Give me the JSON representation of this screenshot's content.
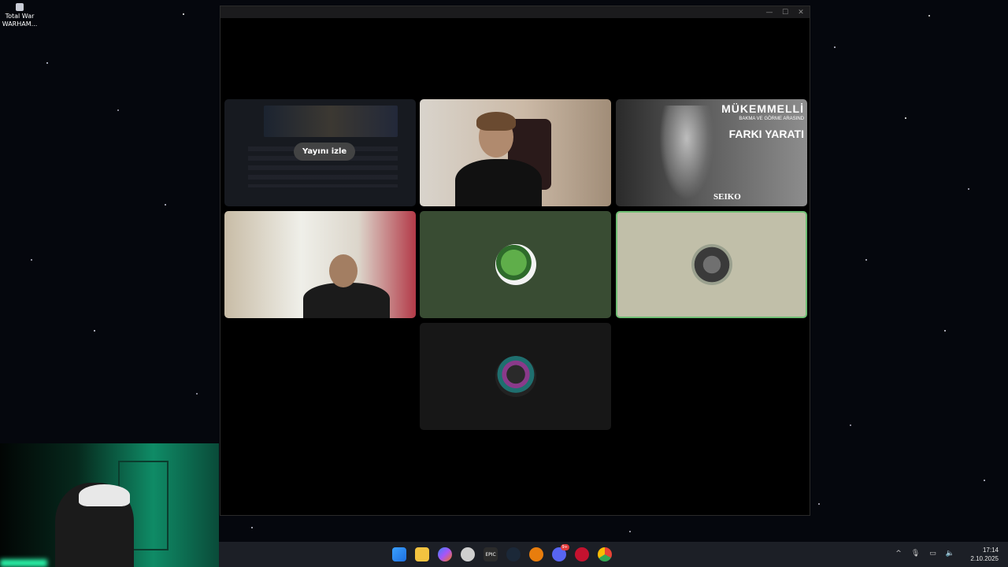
{
  "desktop": {
    "icon": {
      "label": "Total War WARHAM...",
      "icon": "game-shortcut-icon"
    }
  },
  "window": {
    "controls": {
      "minimize": "—",
      "maximize": "☐",
      "close": "✕"
    }
  },
  "call": {
    "tiles": [
      {
        "type": "stream",
        "button_label": "Yayını izle"
      },
      {
        "type": "camera",
        "description": "participant camera"
      },
      {
        "type": "camera-ad",
        "ad_line1": "MÜKEMMELLİ",
        "ad_line2": "BAKMA VE GÖRME ARASIND",
        "ad_line3": "FARKI YARATI",
        "brand": "SEIKO"
      },
      {
        "type": "camera",
        "description": "participant camera"
      },
      {
        "type": "avatar",
        "avatar": "pepe-avatar-icon"
      },
      {
        "type": "avatar",
        "avatar": "tractor-avatar-icon",
        "speaking": true
      },
      {
        "type": "avatar",
        "avatar": "dark-figure-avatar-icon"
      }
    ]
  },
  "taskbar": {
    "apps": [
      {
        "name": "start",
        "icon": "windows-start-icon"
      },
      {
        "name": "file-explorer",
        "icon": "folder-icon"
      },
      {
        "name": "copilot",
        "icon": "copilot-icon"
      },
      {
        "name": "chatgpt",
        "icon": "chatgpt-icon"
      },
      {
        "name": "epic-games",
        "icon": "epic-games-icon",
        "label": "EPIC"
      },
      {
        "name": "steam",
        "icon": "steam-icon"
      },
      {
        "name": "blender",
        "icon": "blender-icon"
      },
      {
        "name": "discord",
        "icon": "discord-icon",
        "badge": "9+"
      },
      {
        "name": "opera",
        "icon": "opera-icon"
      },
      {
        "name": "chrome",
        "icon": "chrome-icon"
      }
    ],
    "tray": {
      "chevron": "^",
      "mic": "🎙",
      "network": "▭",
      "volume": "🔈"
    },
    "clock": {
      "time": "17:14",
      "date": "2.10.2025"
    }
  },
  "colors": {
    "speaking_border": "#6fbf74",
    "taskbar_bg": "#1c1f26"
  }
}
